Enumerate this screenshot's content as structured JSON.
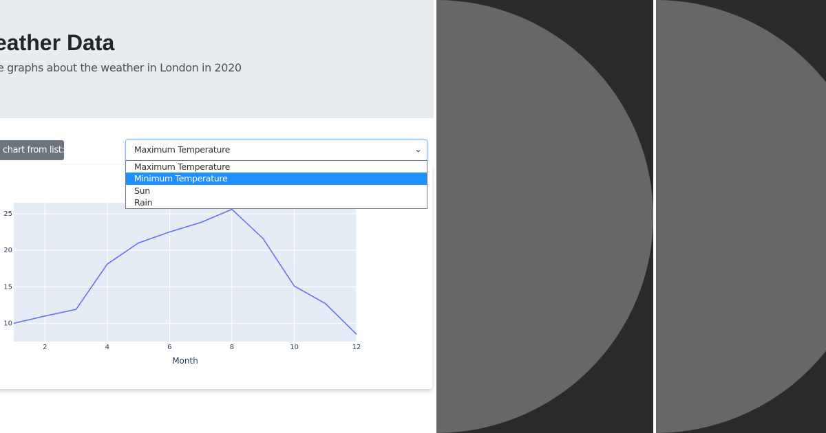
{
  "header": {
    "title": "eather Data",
    "subtitle": "e graphs about the weather in London in 2020"
  },
  "controls": {
    "select_label": "chart from list:",
    "select_value": "Maximum Temperature",
    "options": [
      {
        "label": "Maximum Temperature",
        "selected": false
      },
      {
        "label": "Minimum Temperature",
        "selected": true
      },
      {
        "label": "Sun",
        "selected": false
      },
      {
        "label": "Rain",
        "selected": false
      }
    ]
  },
  "chart_data": {
    "type": "line",
    "title": "",
    "xlabel": "Month",
    "ylabel": "",
    "x": [
      1,
      2,
      3,
      4,
      5,
      6,
      7,
      8,
      9,
      10,
      11,
      12
    ],
    "series": [
      {
        "values": [
          10.0,
          11.0,
          11.9,
          18.1,
          21.0,
          22.5,
          23.8,
          25.6,
          21.6,
          15.1,
          12.7,
          8.5
        ]
      }
    ],
    "xticks": [
      "2",
      "4",
      "6",
      "8",
      "10",
      "12"
    ],
    "yticks": [
      "10",
      "15",
      "20",
      "25"
    ],
    "xlim": [
      1,
      12
    ],
    "ylim": [
      7.5,
      26.5
    ],
    "grid": true,
    "colors": {
      "line": "#636efa",
      "plot_bg": "#e5ecf6",
      "grid": "#ffffff"
    }
  },
  "colors": {
    "jumbotron_bg": "#e9ecef",
    "label_bg": "#6c757d",
    "option_highlight": "#1e90ff",
    "dark_panel": "#2a2a2a",
    "circle": "#676767"
  },
  "icons": {
    "select_arrow": "chevron-down-icon"
  }
}
